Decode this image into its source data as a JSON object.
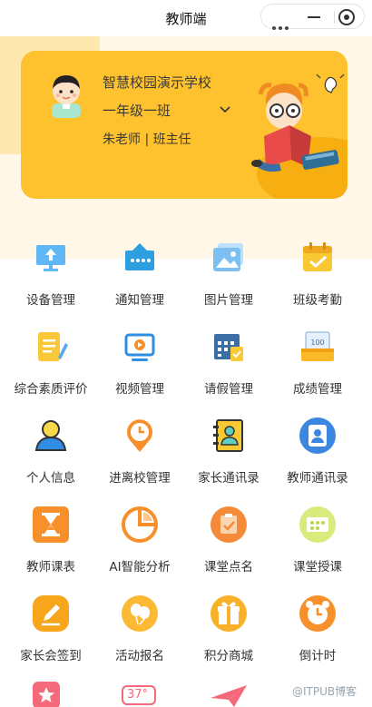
{
  "nav": {
    "title": "教师端"
  },
  "card": {
    "school": "智慧校园演示学校",
    "class_name": "一年级一班",
    "teacher": "朱老师 | 班主任"
  },
  "grid": [
    {
      "label": "设备管理",
      "icon": "device-monitor-icon"
    },
    {
      "label": "通知管理",
      "icon": "notice-icon"
    },
    {
      "label": "图片管理",
      "icon": "picture-icon"
    },
    {
      "label": "班级考勤",
      "icon": "attendance-calendar-icon"
    },
    {
      "label": "综合素质评价",
      "icon": "evaluation-doc-icon"
    },
    {
      "label": "视频管理",
      "icon": "video-icon"
    },
    {
      "label": "请假管理",
      "icon": "leave-calendar-icon"
    },
    {
      "label": "成绩管理",
      "icon": "score-icon"
    },
    {
      "label": "个人信息",
      "icon": "person-icon"
    },
    {
      "label": "进离校管理",
      "icon": "clock-location-icon"
    },
    {
      "label": "家长通讯录",
      "icon": "parent-contacts-icon"
    },
    {
      "label": "教师通讯录",
      "icon": "teacher-contacts-icon"
    },
    {
      "label": "教师课表",
      "icon": "hourglass-icon"
    },
    {
      "label": "AI智能分析",
      "icon": "pie-analysis-icon"
    },
    {
      "label": "课堂点名",
      "icon": "rollcall-icon"
    },
    {
      "label": "课堂授课",
      "icon": "teaching-icon"
    },
    {
      "label": "家长会签到",
      "icon": "signin-pen-icon"
    },
    {
      "label": "活动报名",
      "icon": "balloon-icon"
    },
    {
      "label": "积分商城",
      "icon": "gift-icon"
    },
    {
      "label": "倒计时",
      "icon": "alarm-clock-icon"
    }
  ],
  "bottom": {
    "temp_label": "37°"
  },
  "watermark": "@ITPUB博客",
  "colors": {
    "card": "#fdc22e",
    "accent_orange": "#f7902a",
    "accent_blue": "#2f8de4"
  }
}
